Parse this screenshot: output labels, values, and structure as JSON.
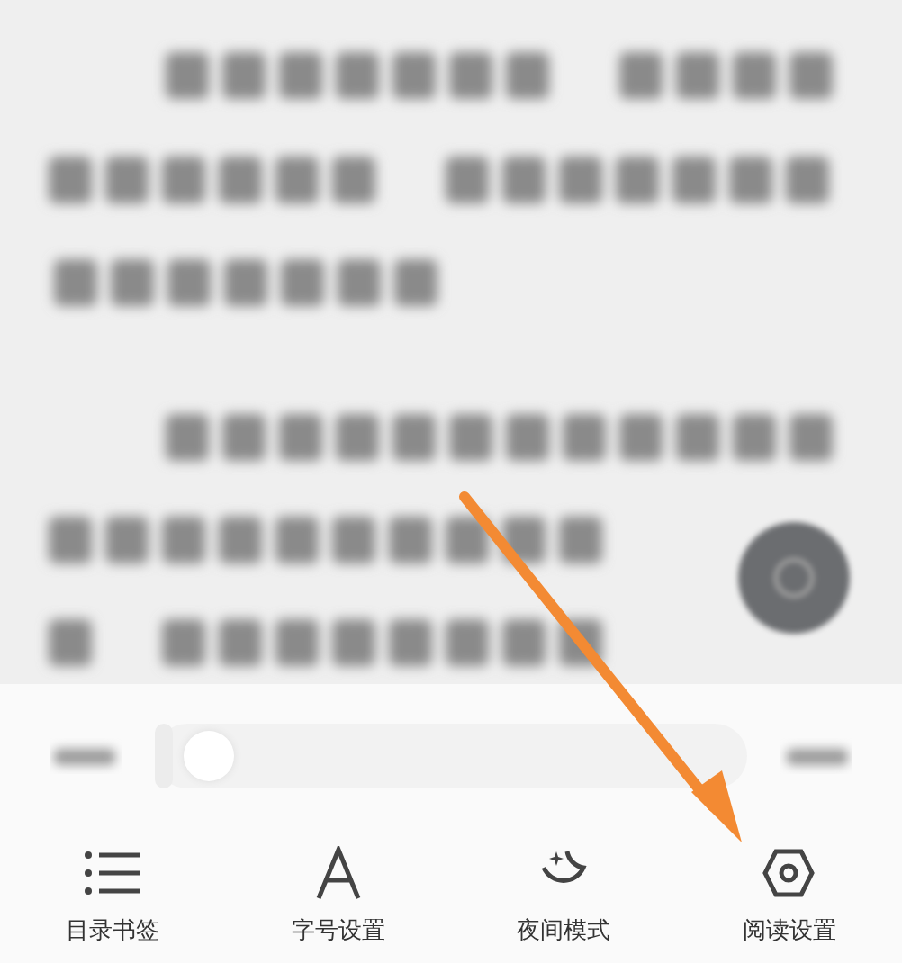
{
  "progress_slider": {
    "level": 0.03
  },
  "tabs": [
    {
      "label": "目录书签",
      "kind": "list"
    },
    {
      "label": "字号设置",
      "kind": "font"
    },
    {
      "label": "夜间模式",
      "kind": "night"
    },
    {
      "label": "阅读设置",
      "kind": "settings"
    }
  ]
}
